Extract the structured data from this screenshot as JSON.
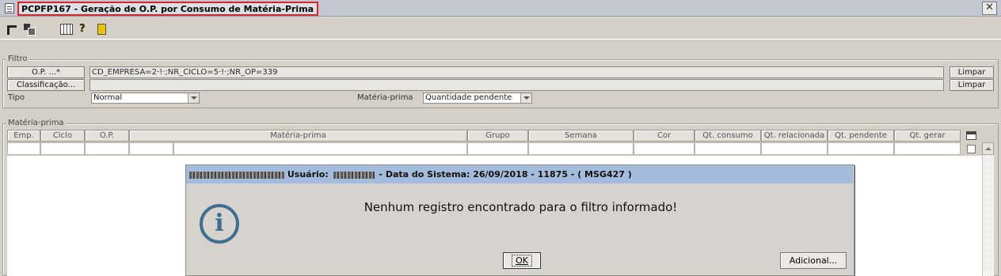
{
  "window": {
    "title": "PCPFP167 - Geração de O.P. por Consumo de Matéria-Prima",
    "close_glyph": "✕"
  },
  "toolbar": {
    "help_glyph": "?"
  },
  "filtro": {
    "legend": "Filtro",
    "op_button": "O.P. ...*",
    "op_value": "CD_EMPRESA=2·!·;NR_CICLO=5·!·;NR_OP=339",
    "class_button": "Classificação...",
    "class_value": "",
    "limpar1": "Limpar",
    "limpar2": "Limpar",
    "tipo_label": "Tipo",
    "tipo_value": "Normal",
    "materia_label": "Matéria-prima",
    "materia_value": "Quantidade pendente"
  },
  "grid": {
    "legend": "Matéria-prima",
    "columns": [
      "Emp.",
      "Ciclo",
      "O.P.",
      "Matéria-prima",
      "Grupo",
      "Semana",
      "Cor",
      "Qt. consumo",
      "Qt. relacionada",
      "Qt. pendente",
      "Qt. gerar"
    ]
  },
  "dialog": {
    "user_label": "Usuário:",
    "header_rest": "- Data do Sistema: 26/09/2018 - 11875 - ( MSG427 )",
    "info_glyph": "i",
    "message": "Nenhum registro encontrado para o filtro informado!",
    "ok": "OK",
    "add": "Adicional..."
  }
}
